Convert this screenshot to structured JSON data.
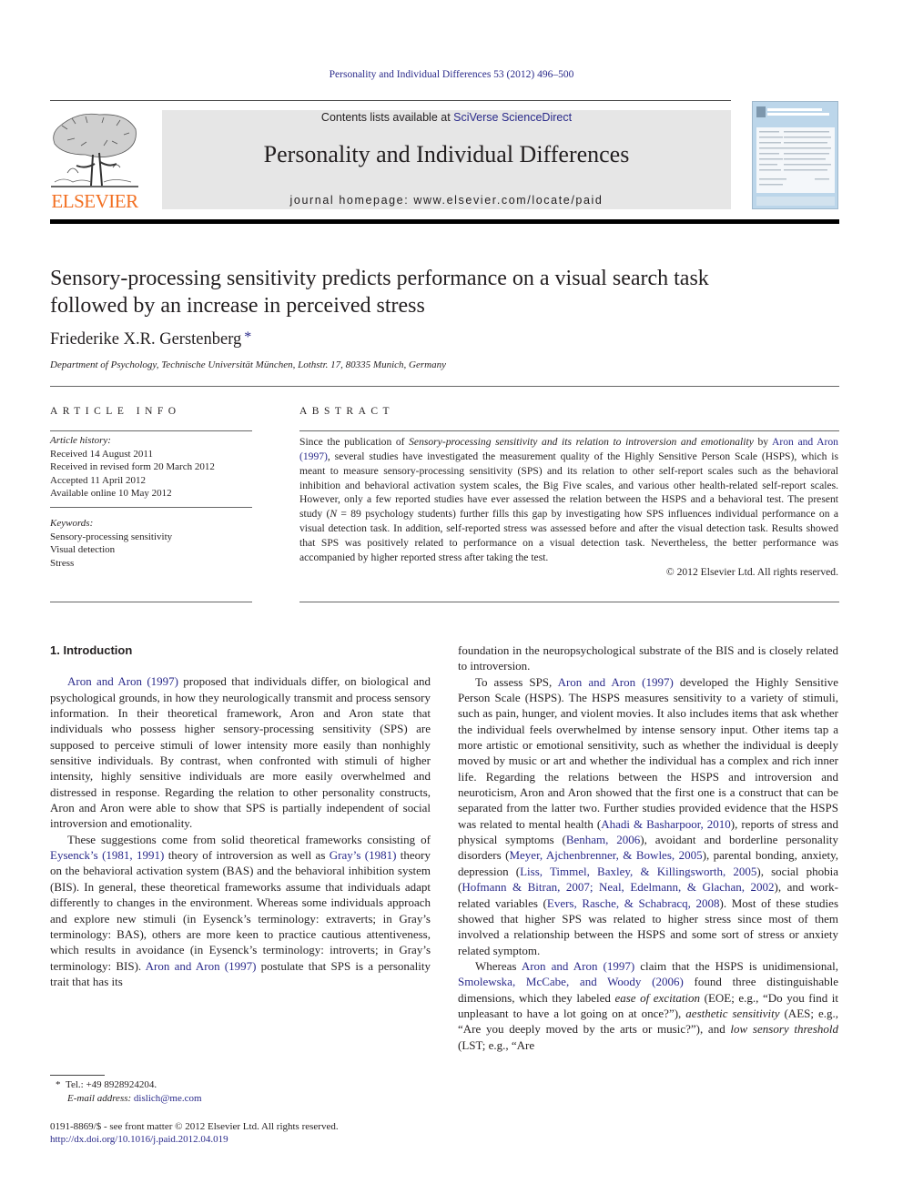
{
  "running_head": "Personality and Individual Differences 53 (2012) 496–500",
  "masthead": {
    "contents_prefix": "Contents lists available at ",
    "contents_link": "SciVerse ScienceDirect",
    "journal_name": "Personality and Individual Differences",
    "homepage": "journal homepage: www.elsevier.com/locate/paid",
    "publisher_logo": "ELSEVIER",
    "brand_color": "#f26f21",
    "link_color": "#2a2a8a"
  },
  "article": {
    "title_line1": "Sensory-processing sensitivity predicts performance on a visual search task",
    "title_line2": "followed by an increase in perceived stress",
    "author": "Friederike X.R. Gerstenberg",
    "author_mark": "*",
    "affiliation": "Department of Psychology, Technische Universität München, Lothstr. 17, 80335 Munich, Germany"
  },
  "article_info": {
    "heading": "ARTICLE INFO",
    "history_label": "Article history:",
    "history": [
      "Received 14 August 2011",
      "Received in revised form 20 March 2012",
      "Accepted 11 April 2012",
      "Available online 10 May 2012"
    ],
    "keywords_label": "Keywords:",
    "keywords": [
      "Sensory-processing sensitivity",
      "Visual detection",
      "Stress"
    ]
  },
  "abstract": {
    "heading": "ABSTRACT",
    "p1_a": "Since the publication of ",
    "p1_ital": "Sensory-processing sensitivity and its relation to introversion and emotionality",
    "p1_b": " by ",
    "p1_link": "Aron and Aron (1997)",
    "p1_c": ", several studies have investigated the measurement quality of the Highly Sensitive Person Scale (HSPS), which is meant to measure sensory-processing sensitivity (SPS) and its relation to other self-report scales such as the behavioral inhibition and behavioral activation system scales, the Big Five scales, and various other health-related self-report scales. However, only a few reported studies have ever assessed the relation between the HSPS and a behavioral test. The present study (",
    "p1_n": "N",
    "p1_d": " = 89 psychology students) further fills this gap by investigating how SPS influences individual performance on a visual detection task. In addition, self-reported stress was assessed before and after the visual detection task. Results showed that SPS was positively related to performance on a visual detection task. Nevertheless, the better performance was accompanied by higher reported stress after taking the test.",
    "copyright": "© 2012 Elsevier Ltd. All rights reserved."
  },
  "body": {
    "section_heading": "1. Introduction",
    "left": {
      "p1_link": "Aron and Aron (1997)",
      "p1_text": " proposed that individuals differ, on biological and psychological grounds, in how they neurologically transmit and process sensory information. In their theoretical framework, Aron and Aron state that individuals who possess higher sensory-processing sensitivity (SPS) are supposed to perceive stimuli of lower intensity more easily than nonhighly sensitive individuals. By contrast, when confronted with stimuli of higher intensity, highly sensitive individuals are more easily overwhelmed and distressed in response. Regarding the relation to other personality constructs, Aron and Aron were able to show that SPS is partially independent of social introversion and emotionality.",
      "p2_a": "These suggestions come from solid theoretical frameworks consisting of ",
      "p2_link1": "Eysenck’s (1981, 1991)",
      "p2_b": " theory of introversion as well as ",
      "p2_link2": "Gray’s (1981)",
      "p2_c": " theory on the behavioral activation system (BAS) and the behavioral inhibition system (BIS). In general, these theoretical frameworks assume that individuals adapt differently to changes in the environment. Whereas some individuals approach and explore new stimuli (in Eysenck’s terminology: extraverts; in Gray’s terminology: BAS), others are more keen to practice cautious attentiveness, which results in avoidance (in Eysenck’s terminology: introverts; in Gray’s terminology: BIS). ",
      "p2_link3": "Aron and Aron (1997)",
      "p2_d": " postulate that SPS is a personality trait that has its"
    },
    "right": {
      "p0": "foundation in the neuropsychological substrate of the BIS and is closely related to introversion.",
      "p1_a": "To assess SPS, ",
      "p1_link": "Aron and Aron (1997)",
      "p1_b": " developed the Highly Sensitive Person Scale (HSPS). The HSPS measures sensitivity to a variety of stimuli, such as pain, hunger, and violent movies. It also includes items that ask whether the individual feels overwhelmed by intense sensory input. Other items tap a more artistic or emotional sensitivity, such as whether the individual is deeply moved by music or art and whether the individual has a complex and rich inner life. Regarding the relations between the HSPS and introversion and neuroticism, Aron and Aron showed that the first one is a construct that can be separated from the latter two. Further studies provided evidence that the HSPS was related to mental health (",
      "p1_link2": "Ahadi & Basharpoor, 2010",
      "p1_c": "), reports of stress and physical symptoms (",
      "p1_link3": "Benham, 2006",
      "p1_d": "), avoidant and borderline personality disorders (",
      "p1_link4": "Meyer, Ajchenbrenner, & Bowles, 2005",
      "p1_e": "), parental bonding, anxiety, depression (",
      "p1_link5": "Liss, Timmel, Baxley, & Killingsworth, 2005",
      "p1_f": "), social phobia (",
      "p1_link6": "Hofmann & Bitran, 2007; Neal, Edelmann, & Glachan, 2002",
      "p1_g": "), and work-related variables (",
      "p1_link7": "Evers, Rasche, & Schabracq, 2008",
      "p1_h": "). Most of these studies showed that higher SPS was related to higher stress since most of them involved a relationship between the HSPS and some sort of stress or anxiety related symptom.",
      "p2_a": "Whereas ",
      "p2_link1": "Aron and Aron (1997)",
      "p2_b": " claim that the HSPS is unidimensional, ",
      "p2_link2": "Smolewska, McCabe, and Woody (2006)",
      "p2_c": " found three distinguishable dimensions, which they labeled ",
      "p2_ital1": "ease of excitation",
      "p2_d": " (EOE; e.g., “Do you find it unpleasant to have a lot going on at once?”), ",
      "p2_ital2": "aesthetic sensitivity",
      "p2_e": " (AES; e.g., “Are you deeply moved by the arts or music?”), and ",
      "p2_ital3": "low sensory threshold",
      "p2_f": " (LST; e.g., “Are"
    }
  },
  "footnote": {
    "mark": "*",
    "tel": "Tel.: +49 8928924204.",
    "email_label": "E-mail address:",
    "email": "dislich@me.com"
  },
  "footer": {
    "issn": "0191-8869/$ - see front matter © 2012 Elsevier Ltd. All rights reserved.",
    "doi": "http://dx.doi.org/10.1016/j.paid.2012.04.019"
  }
}
